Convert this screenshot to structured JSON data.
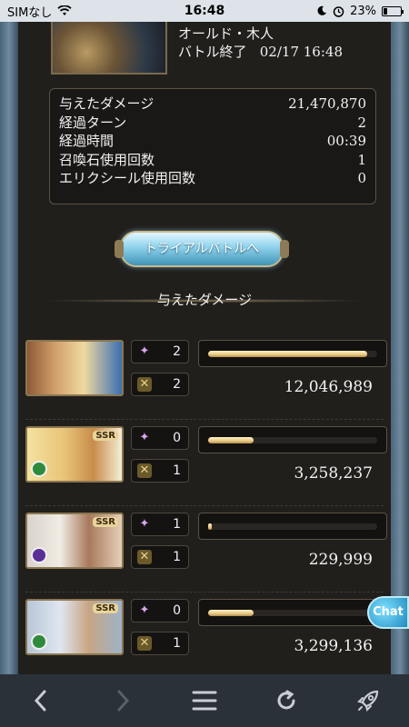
{
  "status_bar": {
    "carrier": "SIMなし",
    "time": "16:48",
    "battery": "23%",
    "battery_level": 0.23
  },
  "boss": {
    "name": "オールド・木人",
    "battle_status": "バトル終了",
    "datetime": "02/17 16:48"
  },
  "stats": [
    {
      "label": "与えたダメージ",
      "value": "21,470,870"
    },
    {
      "label": "経過ターン",
      "value": "2"
    },
    {
      "label": "経過時間",
      "value": "00:39"
    },
    {
      "label": "召喚石使用回数",
      "value": "1"
    },
    {
      "label": "エリクシール使用回数",
      "value": "0"
    }
  ],
  "trial_button": {
    "label": "トライアルバトルへ"
  },
  "damage_section": {
    "title": "与えたダメージ"
  },
  "party": [
    {
      "skill_uses": "2",
      "ougi_uses": "2",
      "damage": "12,046,989",
      "damage_ratio": 0.94,
      "ssr": "",
      "element": ""
    },
    {
      "skill_uses": "0",
      "ougi_uses": "1",
      "damage": "3,258,237",
      "damage_ratio": 0.27,
      "ssr": "SSR",
      "element": "wind"
    },
    {
      "skill_uses": "1",
      "ougi_uses": "1",
      "damage": "229,999",
      "damage_ratio": 0.02,
      "ssr": "SSR",
      "element": "dark"
    },
    {
      "skill_uses": "0",
      "ougi_uses": "1",
      "damage": "3,299,136",
      "damage_ratio": 0.27,
      "ssr": "SSR",
      "element": "wind"
    }
  ],
  "chat": {
    "label": "Chat"
  },
  "icons": {
    "back": "chevron-left-icon",
    "forward": "chevron-right-icon",
    "menu": "menu-icon",
    "reload": "reload-icon",
    "rocket": "rocket-icon"
  }
}
